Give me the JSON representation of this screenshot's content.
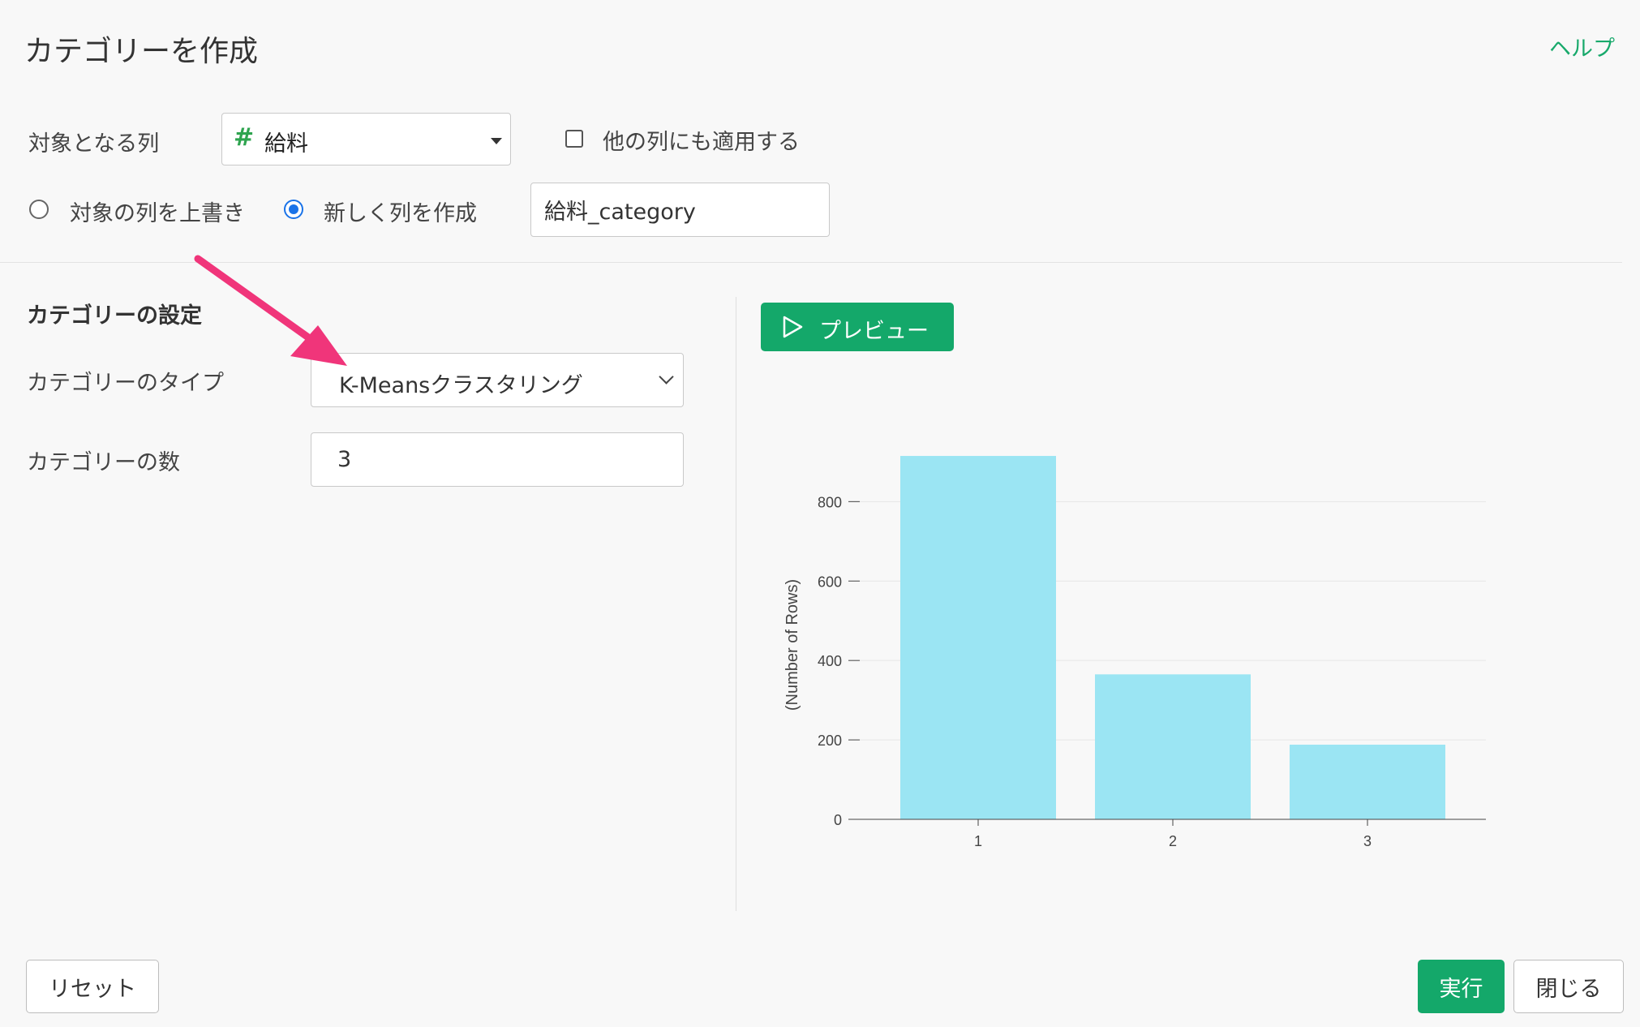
{
  "header": {
    "title": "カテゴリーを作成",
    "help_link": "ヘルプ"
  },
  "target": {
    "label": "対象となる列",
    "column_type_icon": "#",
    "column_value": "給料",
    "apply_other_label": "他の列にも適用する",
    "apply_other_checked": false
  },
  "output": {
    "overwrite_label": "対象の列を上書き",
    "new_column_label": "新しく列を作成",
    "selected": "new_column",
    "new_column_name": "給料_category"
  },
  "settings": {
    "section_title": "カテゴリーの設定",
    "type_label": "カテゴリーのタイプ",
    "type_value": "K-Meansクラスタリング",
    "count_label": "カテゴリーの数",
    "count_value": "3"
  },
  "preview": {
    "button_label": "プレビュー"
  },
  "chart_data": {
    "type": "bar",
    "categories": [
      "1",
      "2",
      "3"
    ],
    "values": [
      915,
      365,
      188
    ],
    "ylabel": "(Number of Rows)",
    "yticks": [
      0,
      200,
      400,
      600,
      800
    ],
    "ylim": [
      0,
      960
    ],
    "bar_color": "#9be5f3",
    "grid": true
  },
  "footer": {
    "reset_label": "リセット",
    "run_label": "実行",
    "close_label": "閉じる"
  },
  "colors": {
    "accent": "#14a86a",
    "radio": "#1a73e8",
    "annotation_arrow": "#f0357a"
  }
}
